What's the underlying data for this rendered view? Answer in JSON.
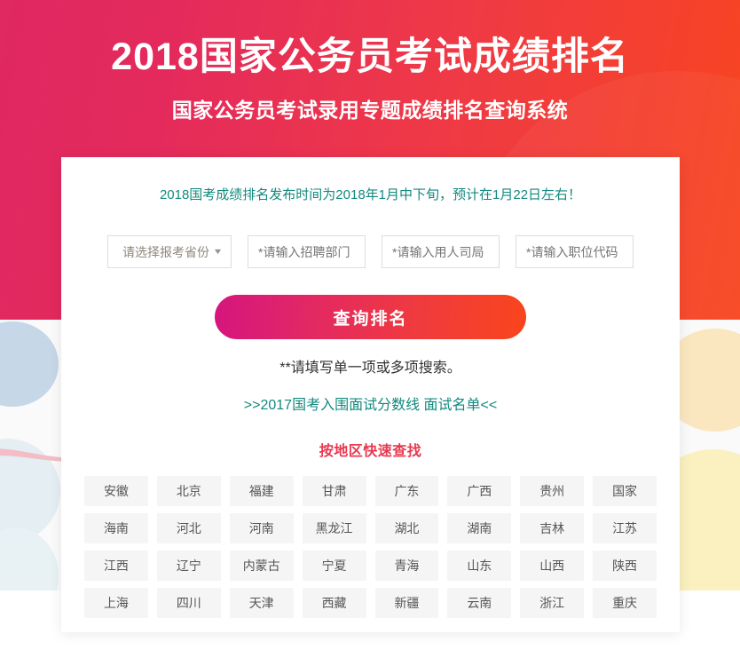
{
  "banner": {
    "title": "2018国家公务员考试成绩排名",
    "subtitle": "国家公务员考试录用专题成绩排名查询系统"
  },
  "card": {
    "notice": "2018国考成绩排名发布时间为2018年1月中下旬，预计在1月22日左右！",
    "form": {
      "province_select": {
        "selected": "请选择报考省份",
        "caret": "▼"
      },
      "inputs": [
        {
          "placeholder": "*请输入招聘部门",
          "value": ""
        },
        {
          "placeholder": "*请输入用人司局",
          "value": ""
        },
        {
          "placeholder": "*请输入职位代码",
          "value": ""
        }
      ]
    },
    "search_button": "查询排名",
    "hint": "**请填写单一项或多项搜索。",
    "sub_link": ">>2017国考入围面试分数线 面试名单<<",
    "region_title": "按地区快速查找",
    "regions": [
      "安徽",
      "北京",
      "福建",
      "甘肃",
      "广东",
      "广西",
      "贵州",
      "国家",
      "海南",
      "河北",
      "河南",
      "黑龙江",
      "湖北",
      "湖南",
      "吉林",
      "江苏",
      "江西",
      "辽宁",
      "内蒙古",
      "宁夏",
      "青海",
      "山东",
      "山西",
      "陕西",
      "上海",
      "四川",
      "天津",
      "西藏",
      "新疆",
      "云南",
      "浙江",
      "重庆"
    ]
  },
  "colors": {
    "banner_from": "#e02861",
    "banner_to": "#f8451f",
    "button_from": "#d5157e",
    "button_to": "#f9451c",
    "notice_text": "#12897e",
    "region_title": "#e8384f",
    "region_cell_bg": "#f5f5f5"
  }
}
